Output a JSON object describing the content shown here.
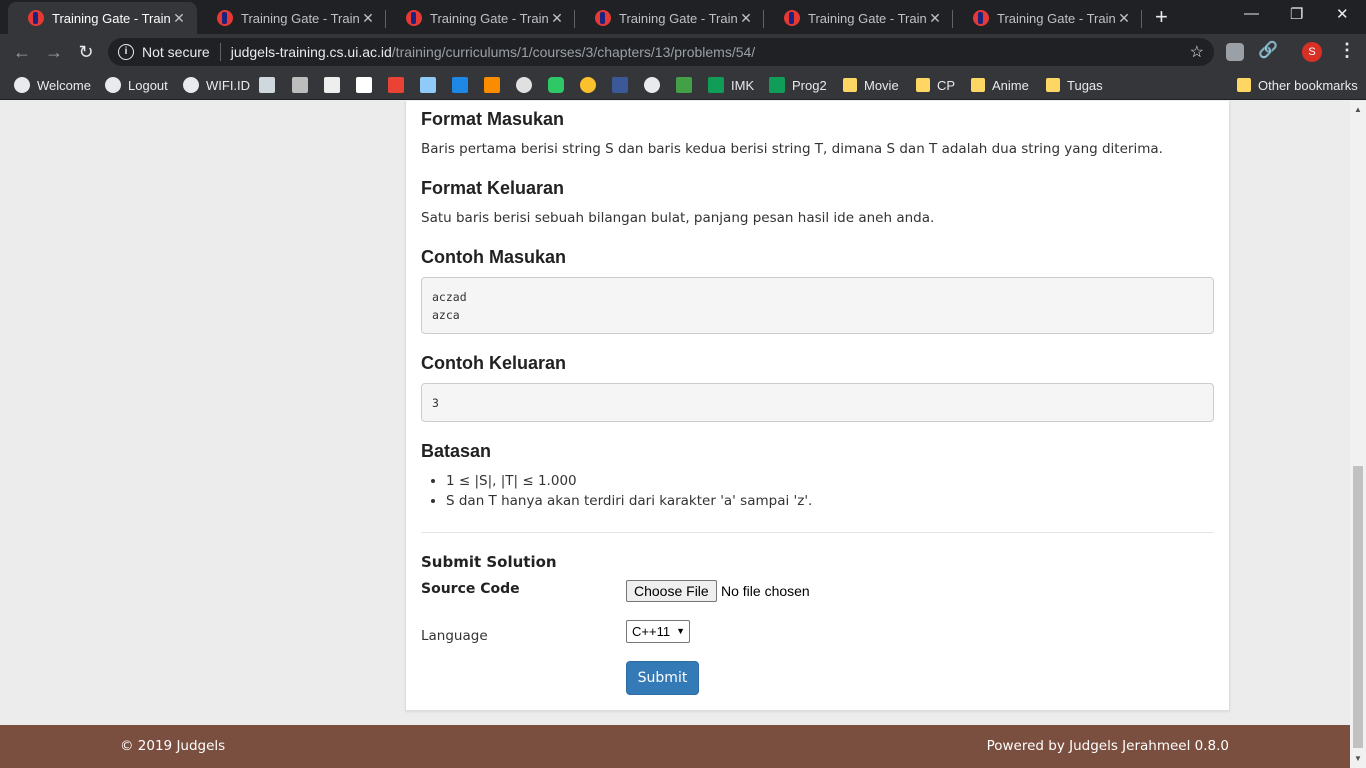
{
  "browser": {
    "tabs": [
      {
        "title": "Training Gate - Training",
        "active": true
      },
      {
        "title": "Training Gate - Training",
        "active": false
      },
      {
        "title": "Training Gate - Training",
        "active": false
      },
      {
        "title": "Training Gate - Training",
        "active": false
      },
      {
        "title": "Training Gate - Training",
        "active": false
      },
      {
        "title": "Training Gate - Training",
        "active": false
      }
    ],
    "new_tab": "+",
    "security_label": "Not secure",
    "url_host": "judgels-training.cs.ui.ac.id",
    "url_path": "/training/curriculums/1/courses/3/chapters/13/problems/54/",
    "profile_initial": "S",
    "bookmarks": {
      "welcome": "Welcome",
      "logout": "Logout",
      "wifi": "WIFI.ID",
      "imk": "IMK",
      "prog2": "Prog2",
      "movie": "Movie",
      "cp": "CP",
      "anime": "Anime",
      "tugas": "Tugas",
      "other": "Other bookmarks"
    }
  },
  "problem": {
    "input_format": {
      "heading": "Format Masukan",
      "text": "Baris pertama berisi string S dan baris kedua berisi string T, dimana S dan T adalah dua string yang diterima."
    },
    "output_format": {
      "heading": "Format Keluaran",
      "text": "Satu baris berisi sebuah bilangan bulat, panjang pesan hasil ide aneh anda."
    },
    "sample_input": {
      "heading": "Contoh Masukan",
      "text": "aczad\nazca"
    },
    "sample_output": {
      "heading": "Contoh Keluaran",
      "text": "3"
    },
    "constraints": {
      "heading": "Batasan",
      "items": [
        "1 ≤ |S|, |T| ≤ 1.000",
        "S dan T hanya akan terdiri dari karakter 'a' sampai 'z'."
      ]
    }
  },
  "submit": {
    "heading": "Submit Solution",
    "source_label": "Source Code",
    "choose_file": "Choose File",
    "no_file": "No file chosen",
    "language_label": "Language",
    "language_value": "C++11",
    "submit_button": "Submit"
  },
  "footer": {
    "copyright": "© 2019 Judgels",
    "powered": "Powered by Judgels Jerahmeel 0.8.0"
  },
  "colors": {
    "footer_bg": "#7a4f3f",
    "submit_bg": "#337ab7"
  }
}
